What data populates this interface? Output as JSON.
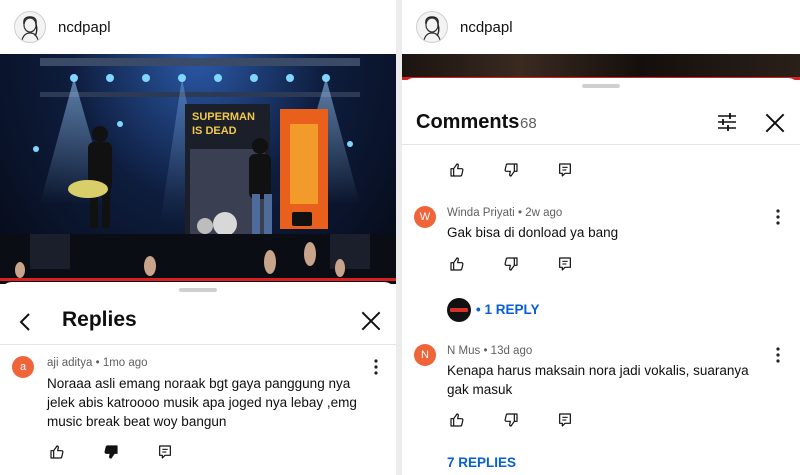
{
  "left": {
    "username": "ncdpapl",
    "video": {
      "banner_line1": "SUPERMAN",
      "banner_line2": "IS DEAD"
    },
    "replies": {
      "title": "Replies",
      "comment": {
        "avatar_letter": "a",
        "avatar_color": "#f0643a",
        "author": "aji aditya",
        "time": "1mo ago",
        "text": "Noraaa asli emang noraak bgt gaya panggung nya jelek abis katroooo musik apa joged nya lebay ,emg music break beat woy bangun"
      }
    }
  },
  "right": {
    "username": "ncdpapl",
    "comments": {
      "title": "Comments",
      "count": "68",
      "items": [
        {
          "avatar_letter": "W",
          "avatar_color": "#f0643a",
          "author": "Winda Priyati",
          "time": "2w ago",
          "text": "Gak bisa di donload ya bang",
          "reply_label": "• 1 REPLY"
        },
        {
          "avatar_letter": "N",
          "avatar_color": "#f0643a",
          "author": "N Mus",
          "time": "13d ago",
          "text": "Kenapa harus maksain nora jadi vokalis, suaranya gak masuk",
          "reply_label": "7 REPLIES"
        }
      ]
    }
  },
  "colors": {
    "link": "#065fd4",
    "progress": "#d82020"
  },
  "icons": [
    "user-avatar-icon",
    "chevron-left-icon",
    "close-icon",
    "more-vert-icon",
    "thumb-up-icon",
    "thumb-down-icon",
    "comment-reply-icon",
    "tune-icon"
  ]
}
